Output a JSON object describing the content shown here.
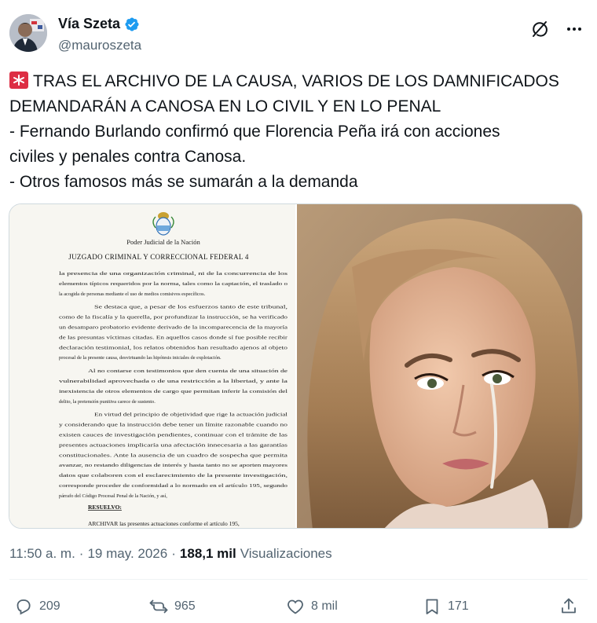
{
  "author": {
    "display_name": "Vía Szeta",
    "handle": "@mauroszeta",
    "verified": true
  },
  "header_icons": [
    "grok-icon",
    "more-icon"
  ],
  "tweet": {
    "lines": [
      "TRAS EL ARCHIVO DE LA CAUSA, VARIOS DE LOS DAMNIFICADOS",
      "DEMANDARÁN A CANOSA EN LO CIVIL Y EN LO PENAL",
      "- Fernando Burlando confirmó que Florencia Peña irá con acciones",
      "civiles y penales contra Canosa.",
      "- Otros famosos más se sumarán a la demanda"
    ]
  },
  "document": {
    "institution": "Poder Judicial de la Nación",
    "court": "JUZGADO CRIMINAL Y CORRECCIONAL FEDERAL 4",
    "paragraphs": [
      "la presencia de una organización criminal, ni de la concurrencia de los",
      "elementos típicos requeridos por la norma, tales como la captación, el traslado o",
      "la acogida de personas mediante el uso de medios comisivos específicos.",
      "Se destaca que, a pesar de los esfuerzos tanto de este tribunal,",
      "como de la fiscalía y la querella, por profundizar la instrucción, se ha verificado",
      "un desamparo probatorio evidente derivado de la incomparecencia de la mayoría",
      "de las presuntas víctimas citadas. En aquellos casos donde sí fue posible recibir",
      "declaración testimonial, los relatos obtenidos han resultado ajenos al objeto",
      "procesal de la presente causa, desvirtuando las hipótesis iniciales de explotación.",
      "Al no contarse con testimonios que den cuenta de una situación de",
      "vulnerabilidad aprovechada o de una restricción a la libertad, y ante la",
      "inexistencia de otros elementos de cargo que permitan inferir la comisión del",
      "delito, la pretensión punitiva carece de sustento.",
      "En virtud del principio de objetividad que rige la actuación judicial",
      "y considerando que la instrucción debe tener un límite razonable cuando no",
      "existen cauces de investigación pendientes, continuar con el trámite de las",
      "presentes actuaciones implicaría una afectación innecesaria a las garantías",
      "constitucionales. Ante la ausencia de un cuadro de sospecha que permita",
      "avanzar, no restando diligencias de interés y hasta tanto no se aporten mayores",
      "datos que colaboren con el esclarecimiento de la presente investigación,",
      "corresponde proceder de conformidad a lo normado en el artículo 195, segundo",
      "párrafo del Código Procesal Penal de la Nación, y así,"
    ],
    "resolution_heading": "RESUELVO:",
    "resolution_text": "ARCHIVAR las presentes actuaciones conforme el artículo 195,"
  },
  "meta": {
    "time": "11:50 a. m.",
    "separator": "·",
    "date": "19 may. 2026",
    "views_count": "188,1 mil",
    "views_label": "Visualizaciones"
  },
  "actions": {
    "replies": "209",
    "reposts": "965",
    "likes": "8 mil",
    "bookmarks": "171"
  },
  "colors": {
    "text": "#0f1419",
    "secondary": "#536471",
    "verified_blue": "#1d9bf0",
    "siren_red": "#dd2e44",
    "divider": "#eff3f4",
    "border": "#cfd9de"
  }
}
